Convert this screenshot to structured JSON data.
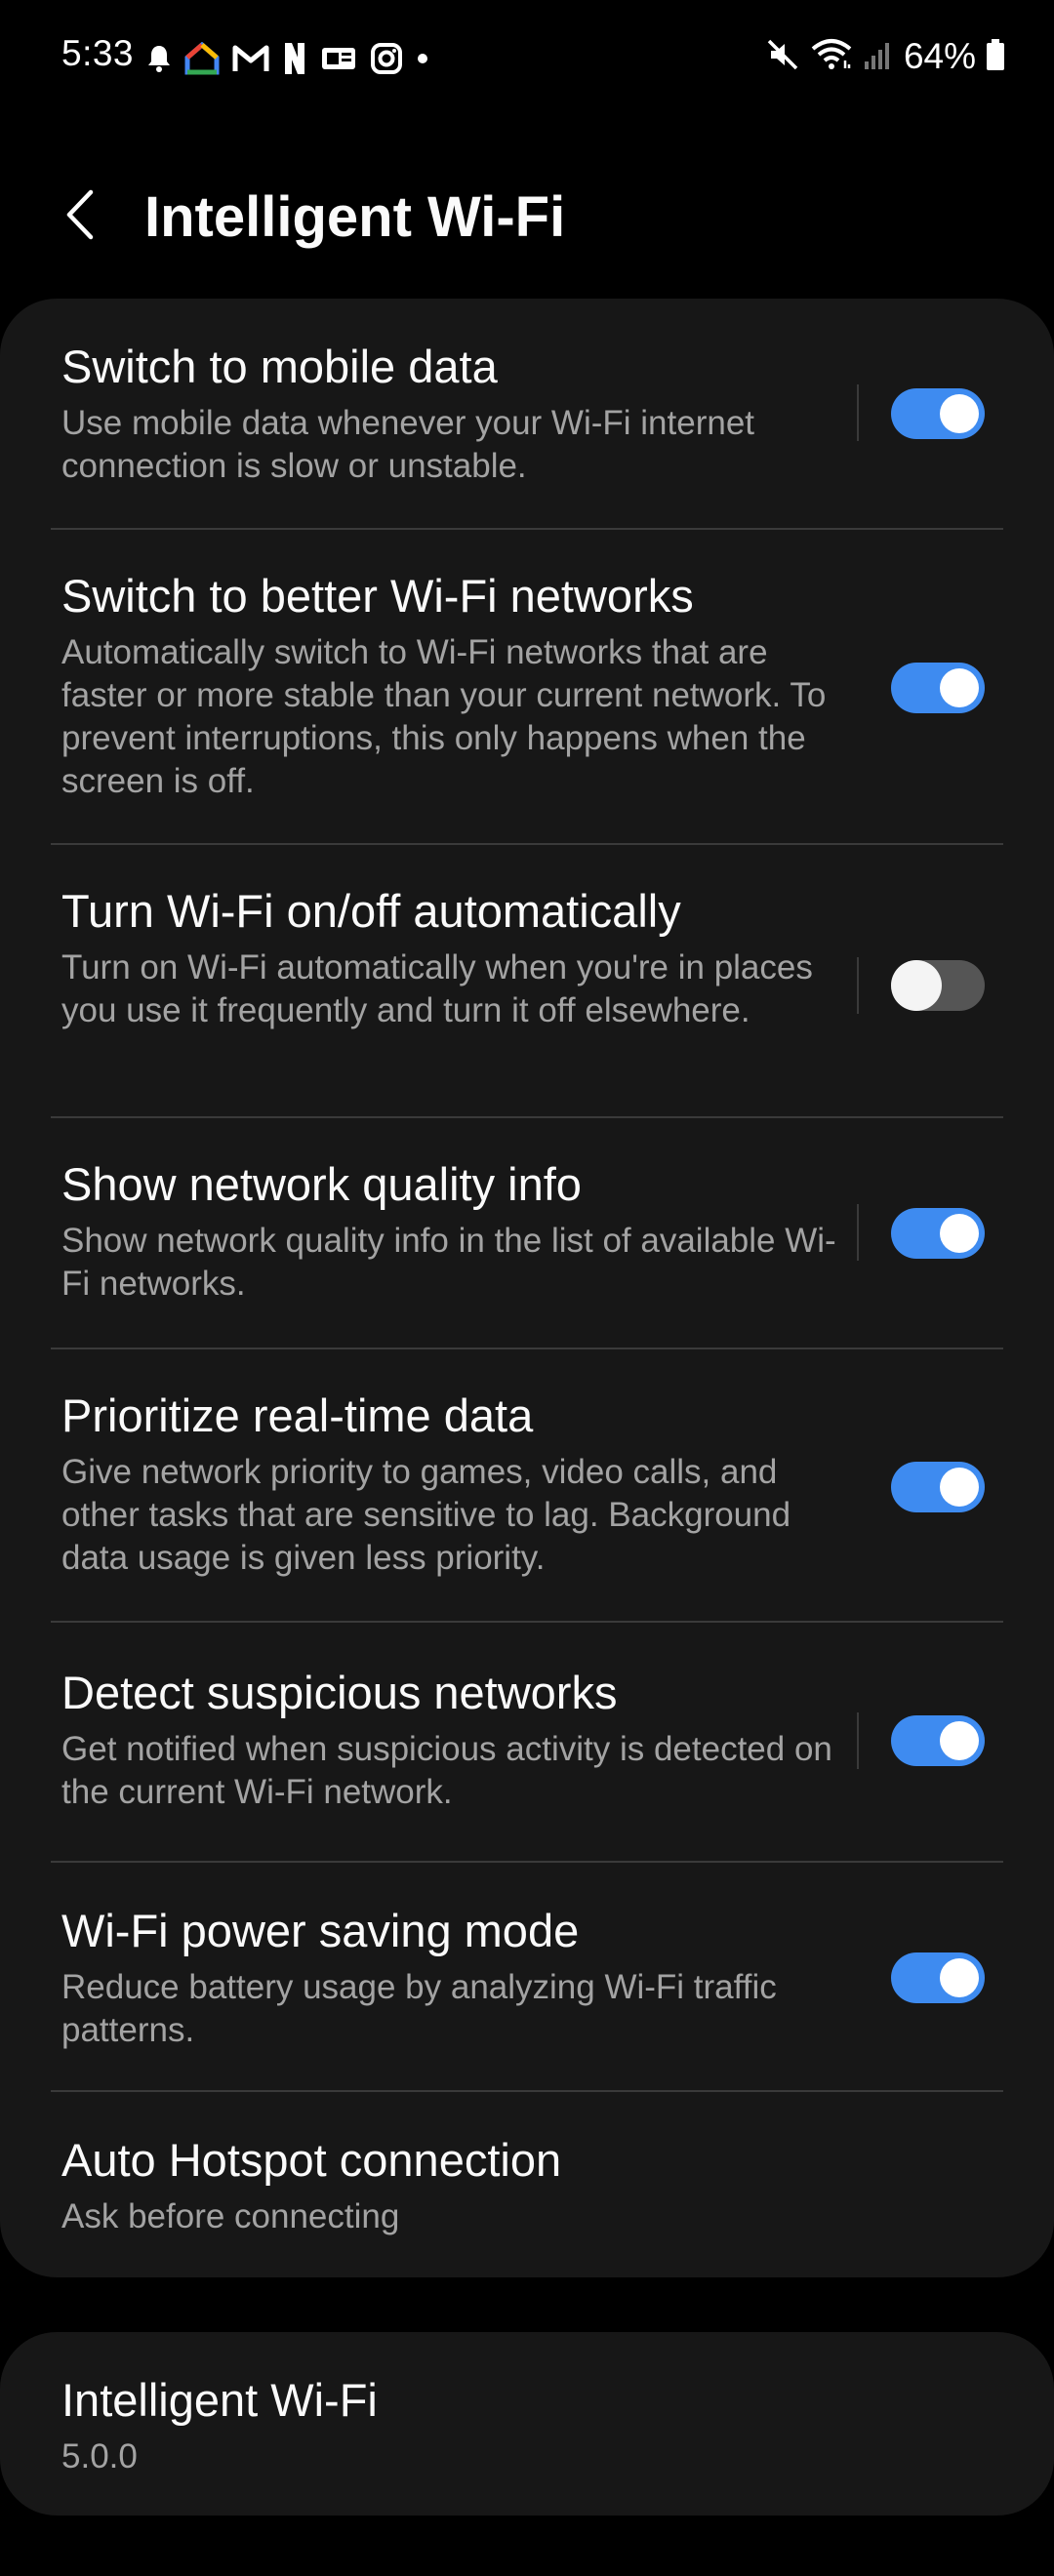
{
  "status_bar": {
    "time": "5:33",
    "battery_percent": "64%",
    "notification_icons": [
      "bell-icon",
      "google-home-icon",
      "gmail-icon",
      "netflix-icon",
      "news-icon",
      "instagram-icon",
      "dot-icon"
    ],
    "right_icons": [
      "mute-icon",
      "wifi-icon",
      "signal-icon",
      "battery-icon"
    ]
  },
  "header": {
    "title": "Intelligent Wi-Fi",
    "back_icon": "chevron-left-icon"
  },
  "settings": [
    {
      "title": "Switch to mobile data",
      "description": "Use mobile data whenever your Wi-Fi internet connection is slow or unstable.",
      "enabled": true
    },
    {
      "title": "Switch to better Wi-Fi networks",
      "description": "Automatically switch to Wi-Fi networks that are faster or more stable than your current network. To prevent interruptions, this only happens when the screen is off.",
      "enabled": true
    },
    {
      "title": "Turn Wi-Fi on/off automatically",
      "description": "Turn on Wi-Fi automatically when you're in places you use it frequently and turn it off elsewhere.",
      "enabled": false
    },
    {
      "title": "Show network quality info",
      "description": "Show network quality info in the list of available Wi-Fi networks.",
      "enabled": true
    },
    {
      "title": "Prioritize real-time data",
      "description": "Give network priority to games, video calls, and other tasks that are sensitive to lag. Background data usage is given less priority.",
      "enabled": true
    },
    {
      "title": "Detect suspicious networks",
      "description": "Get notified when suspicious activity is detected on the current Wi-Fi network.",
      "enabled": true
    },
    {
      "title": "Wi-Fi power saving mode",
      "description": "Reduce battery usage by analyzing Wi-Fi traffic patterns.",
      "enabled": true
    }
  ],
  "auto_hotspot": {
    "title": "Auto Hotspot connection",
    "value": "Ask before connecting"
  },
  "about": {
    "title": "Intelligent Wi-Fi",
    "version": "5.0.0"
  },
  "colors": {
    "background": "#000000",
    "card": "#171717",
    "accent": "#3e8bf0",
    "secondary_text": "#a3a3a3"
  }
}
